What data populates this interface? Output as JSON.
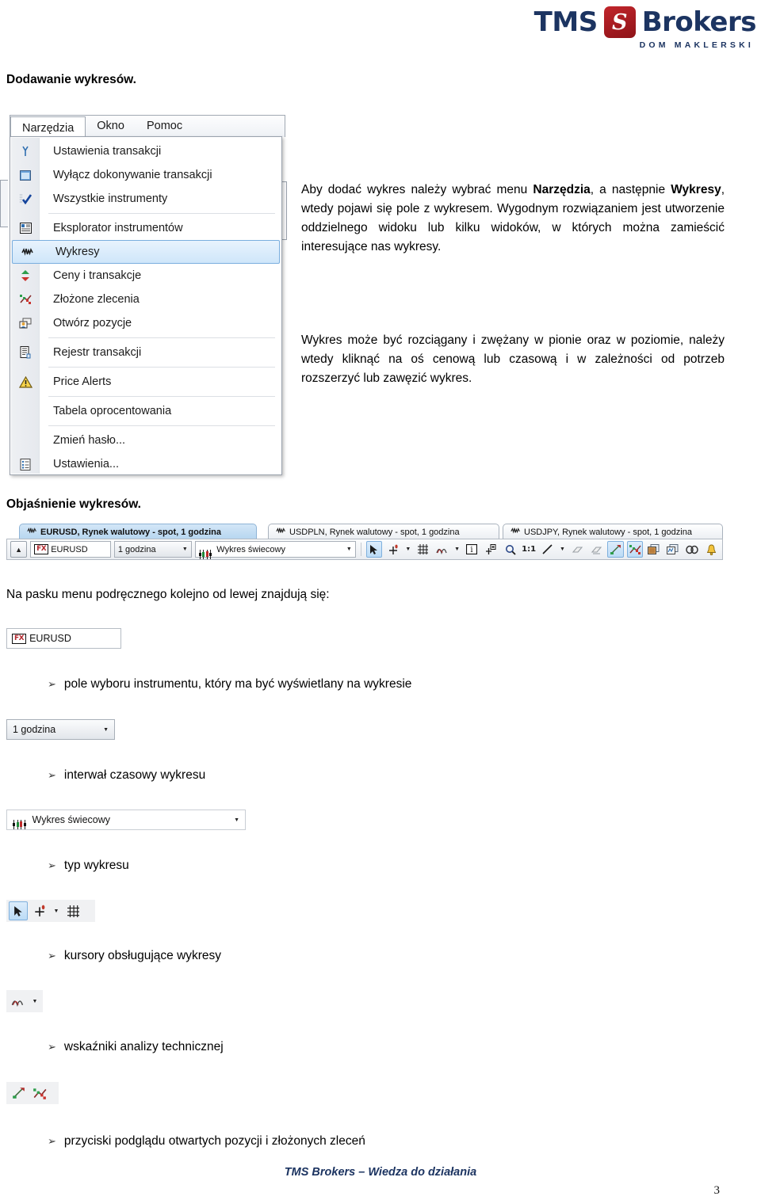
{
  "brand": {
    "name_left": "TMS",
    "name_right": "Brokers",
    "mark_letter": "S",
    "tagline": "DOM MAKLERSKI",
    "color_navy": "#1c3461",
    "color_red": "#b3292f"
  },
  "sections": {
    "heading_add_charts": "Dodawanie wykresów.",
    "heading_explain_charts": "Objaśnienie wykresów.",
    "toolbar_intro": "Na pasku menu podręcznego kolejno od lewej znajdują się:"
  },
  "paragraphs": {
    "p1_a": "Aby dodać wykres należy wybrać menu ",
    "p1_b": "Narzędzia",
    "p1_c": ", a następnie ",
    "p1_d": "Wykresy",
    "p1_e": ", wtedy pojawi się pole z wykresem. Wygodnym rozwiązaniem jest utworzenie oddzielnego widoku lub kilku widoków, w których można zamieścić interesujące nas wykresy.",
    "p2": "Wykres może być rozciągany i zwężany w pionie oraz w poziomie, należy wtedy kliknąć na oś cenową lub czasową i w zależności od potrzeb rozszerzyć lub zawęzić wykres."
  },
  "menu_screenshot": {
    "menubar": [
      {
        "label": "Narzędzia",
        "active": true
      },
      {
        "label": "Okno",
        "active": false
      },
      {
        "label": "Pomoc",
        "active": false
      }
    ],
    "items": [
      {
        "label": "Ustawienia transakcji",
        "icon": "wrench-icon",
        "glyph": "⑂",
        "selected": false,
        "separator_after": false
      },
      {
        "label": "Wyłącz dokonywanie transakcji",
        "icon": "window-block-icon",
        "glyph": "▣",
        "selected": false,
        "separator_after": false
      },
      {
        "label": "Wszystkie instrumenty",
        "icon": "checkmark-icon",
        "glyph": "✔",
        "selected": false,
        "separator_after": true
      },
      {
        "label": "Eksplorator instrumentów",
        "icon": "explorer-icon",
        "glyph": "▦",
        "selected": false,
        "separator_after": false
      },
      {
        "label": "Wykresy",
        "icon": "chart-wave-icon",
        "glyph": "∿",
        "selected": true,
        "separator_after": false
      },
      {
        "label": "Ceny i transakcje",
        "icon": "up-down-arrow-icon",
        "glyph": "⬍",
        "selected": false,
        "separator_after": false
      },
      {
        "label": "Złożone zlecenia",
        "icon": "orders-icon",
        "glyph": "❇",
        "selected": false,
        "separator_after": false
      },
      {
        "label": "Otwórz pozycje",
        "icon": "positions-icon",
        "glyph": "⛁",
        "selected": false,
        "separator_after": true
      },
      {
        "label": "Rejestr transakcji",
        "icon": "document-icon",
        "glyph": "🗎",
        "selected": false,
        "separator_after": true
      },
      {
        "label": "Price Alerts",
        "icon": "warning-icon",
        "glyph": "⚠",
        "selected": false,
        "separator_after": true
      },
      {
        "label": "Tabela oprocentowania",
        "icon": "none",
        "glyph": "",
        "selected": false,
        "separator_after": true
      },
      {
        "label": "Zmień hasło...",
        "icon": "none",
        "glyph": "",
        "selected": false,
        "separator_after": false
      },
      {
        "label": "Ustawienia...",
        "icon": "settings-icon",
        "glyph": "▤",
        "selected": false,
        "separator_after": false
      }
    ]
  },
  "chart_toolbar": {
    "tabs": [
      {
        "label": "EURUSD, Rynek walutowy - spot, 1 godzina",
        "active": true
      },
      {
        "label": "USDPLN, Rynek walutowy - spot, 1 godzina",
        "active": false
      },
      {
        "label": "USDJPY, Rynek walutowy - spot, 1 godzina",
        "active": false
      }
    ],
    "collapse_button": "▲",
    "instrument_badge": "FX",
    "instrument_value": "EURUSD",
    "interval_value": "1 godzina",
    "chart_type_value": "Wykres świecowy",
    "zoom_ratio_label": "1:1",
    "info_label": "i",
    "icons": [
      {
        "name": "cursor-arrow-icon",
        "glyph": "➤",
        "active": true,
        "dim": false
      },
      {
        "name": "crosshair-cursor-icon",
        "glyph": "✛",
        "active": false,
        "dim": false
      },
      {
        "name": "cursor-dropdown-icon",
        "glyph": "▾",
        "active": false,
        "dim": false
      },
      {
        "name": "grid-icon",
        "glyph": "▦",
        "active": false,
        "dim": false
      },
      {
        "name": "indicators-icon",
        "glyph": "∿",
        "active": false,
        "dim": false
      },
      {
        "name": "indicators-dropdown-icon",
        "glyph": "▾",
        "active": false,
        "dim": false
      },
      {
        "name": "info-box-icon",
        "glyph": "i",
        "active": false,
        "dim": false
      },
      {
        "name": "add-annotation-icon",
        "glyph": "⊞",
        "active": false,
        "dim": false
      },
      {
        "name": "zoom-icon",
        "glyph": "🔍",
        "active": false,
        "dim": false
      },
      {
        "name": "scale-one-to-one-icon",
        "glyph": "1:1",
        "active": false,
        "dim": false
      },
      {
        "name": "trendline-icon",
        "glyph": "╲",
        "active": false,
        "dim": false
      },
      {
        "name": "trendline-dropdown-icon",
        "glyph": "▾",
        "active": false,
        "dim": false
      },
      {
        "name": "eraser-icon",
        "glyph": "◇",
        "active": false,
        "dim": true
      },
      {
        "name": "clear-drawings-icon",
        "glyph": "◈",
        "active": false,
        "dim": true
      },
      {
        "name": "open-positions-icon",
        "glyph": "↗",
        "active": true,
        "dim": false
      },
      {
        "name": "pending-orders-icon",
        "glyph": "❇",
        "active": true,
        "dim": false
      },
      {
        "name": "copy-chart-icon",
        "glyph": "❐",
        "active": false,
        "dim": false
      },
      {
        "name": "save-chart-icon",
        "glyph": "❑",
        "active": false,
        "dim": false
      },
      {
        "name": "link-charts-icon",
        "glyph": "👁",
        "active": false,
        "dim": false
      },
      {
        "name": "price-alert-bell-icon",
        "glyph": "🔔",
        "active": false,
        "dim": false
      }
    ]
  },
  "snippets": {
    "instrument": {
      "badge": "FX",
      "value": "EURUSD",
      "caption": "pole wyboru instrumentu, który ma być wyświetlany na wykresie"
    },
    "interval": {
      "value": "1 godzina",
      "caption": "interwał czasowy wykresu"
    },
    "chart_type": {
      "value": "Wykres świecowy",
      "caption": "typ wykresu"
    },
    "cursors": {
      "caption": "kursory obsługujące wykresy",
      "icons": [
        {
          "name": "cursor-arrow-icon",
          "glyph": "➤",
          "active": true
        },
        {
          "name": "crosshair-cursor-icon",
          "glyph": "✛",
          "active": false
        },
        {
          "name": "cursor-dropdown-icon",
          "glyph": "▾",
          "active": false
        },
        {
          "name": "grid-icon",
          "glyph": "▦",
          "active": false
        }
      ]
    },
    "indicators": {
      "caption": "wskaźniki analizy technicznej",
      "icons": [
        {
          "name": "indicators-icon",
          "glyph": "∿",
          "active": false
        },
        {
          "name": "indicators-dropdown-icon",
          "glyph": "▾",
          "active": false
        }
      ]
    },
    "positions_orders": {
      "caption": "przyciski podglądu otwartych pozycji i złożonych zleceń",
      "icons": [
        {
          "name": "open-positions-icon",
          "glyph": "↗",
          "active": false
        },
        {
          "name": "pending-orders-icon",
          "glyph": "❇",
          "active": false
        }
      ]
    }
  },
  "footer": {
    "text": "TMS Brokers – Wiedza do działania",
    "page_number": "3"
  }
}
